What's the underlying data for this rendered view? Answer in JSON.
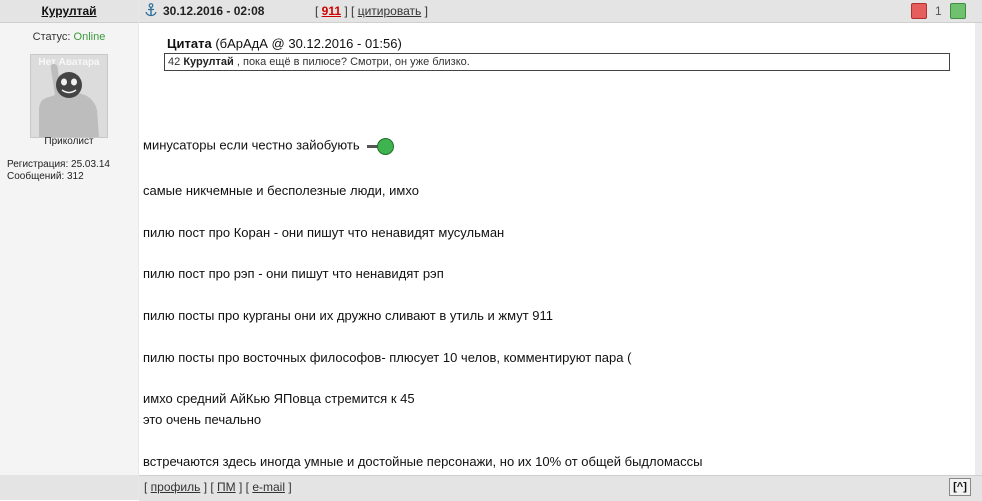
{
  "author": {
    "username": "Курултай",
    "status_label": "Статус:",
    "status_value": "Online",
    "avatar_text": "Нет Аватара",
    "rank": "Приколист",
    "registration": "Регистрация: 25.03.14",
    "posts": "Сообщений: 312"
  },
  "post": {
    "date": "30.12.2016 - 02:08",
    "number": "911",
    "quote_link": "цитировать",
    "rating": "1"
  },
  "quote": {
    "label": "Цитата",
    "source": "(бАрАдА @ 30.12.2016 - 01:56)",
    "num": "42",
    "name": "Курултай",
    "text": ", пока ещё в пилюсе? Смотри, он уже близко."
  },
  "body": {
    "lines": [
      "минусаторы если честно зайобують",
      "самые никчемные и бесполезные люди, имхо",
      "пилю пост про Коран - они пишут что ненавидят мусульман",
      "пилю пост про рэп - они пишут что ненавидят рэп",
      "пилю посты про курганы они их дружно сливают в утиль и жмут 911",
      "пилю посты про восточных философов- плюсует 10 челов, комментируют пара (",
      "имхо средний АйКью ЯПовца стремится к 45",
      "это очень печально",
      "встречаются здесь иногда умные и достойные персонажи, но их 10% от общей быдломассы"
    ]
  },
  "footer": {
    "profile": "профиль",
    "pm": "ПМ",
    "email": "e-mail",
    "top": "[^]"
  },
  "icons": {
    "anchor": "anchor-icon",
    "thumb_down": "thumb-down-icon",
    "thumb_up": "thumb-up-icon",
    "smiley": "gun-smiley-icon"
  }
}
